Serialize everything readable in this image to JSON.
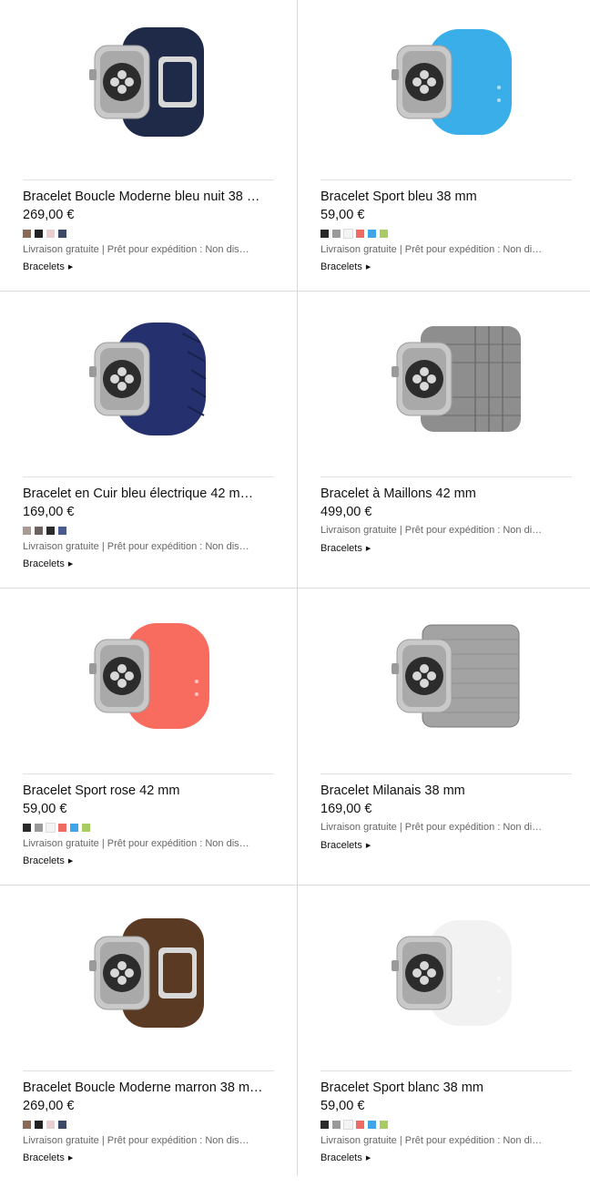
{
  "products": [
    {
      "name": "Bracelet Boucle Moderne bleu nuit 38 …",
      "price": "269,00 €",
      "swatches": [
        "#8a6a55",
        "#222222",
        "#e7cfcf",
        "#3d4a66"
      ],
      "shipping": "Livraison gratuite | Prêt pour expédition : Non dis…",
      "category": "Bracelets",
      "image": "midnight blue modern buckle band",
      "band_color": "#1e2a47"
    },
    {
      "name": "Bracelet Sport bleu 38 mm",
      "price": "59,00 €",
      "swatches": [
        "#2a2a2a",
        "#9a9a9a",
        "#f4f4f4",
        "#ee6b64",
        "#3ea6e8",
        "#a7cc63"
      ],
      "shipping": "Livraison gratuite | Prêt pour expédition : Non di…",
      "category": "Bracelets",
      "image": "blue sport band",
      "band_color": "#3aaee9"
    },
    {
      "name": "Bracelet en Cuir bleu électrique 42 m…",
      "price": "169,00 €",
      "swatches": [
        "#a99a92",
        "#6c6260",
        "#2b2b2b",
        "#4b5a8c"
      ],
      "shipping": "Livraison gratuite | Prêt pour expédition : Non dis…",
      "category": "Bracelets",
      "image": "bright blue leather loop",
      "band_color": "#25316e"
    },
    {
      "name": "Bracelet à Maillons 42 mm",
      "price": "499,00 €",
      "swatches": [],
      "shipping": "Livraison gratuite | Prêt pour expédition : Non di…",
      "category": "Bracelets",
      "image": "stainless steel link bracelet",
      "band_color": "#8e8e8e"
    },
    {
      "name": "Bracelet Sport rose 42 mm",
      "price": "59,00 €",
      "swatches": [
        "#2a2a2a",
        "#9a9a9a",
        "#f4f4f4",
        "#ee6b64",
        "#3ea6e8",
        "#a7cc63"
      ],
      "shipping": "Livraison gratuite | Prêt pour expédition : Non dis…",
      "category": "Bracelets",
      "image": "pink sport band",
      "band_color": "#f86c60"
    },
    {
      "name": "Bracelet Milanais 38 mm",
      "price": "169,00 €",
      "swatches": [],
      "shipping": "Livraison gratuite | Prêt pour expédition : Non di…",
      "category": "Bracelets",
      "image": "milanese loop",
      "band_color": "#a3a3a3"
    },
    {
      "name": "Bracelet Boucle Moderne marron 38 m…",
      "price": "269,00 €",
      "swatches": [
        "#8a6a55",
        "#222222",
        "#e7cfcf",
        "#3d4a66"
      ],
      "shipping": "Livraison gratuite | Prêt pour expédition : Non dis…",
      "category": "Bracelets",
      "image": "brown modern buckle band",
      "band_color": "#5a3a22"
    },
    {
      "name": "Bracelet Sport blanc 38 mm",
      "price": "59,00 €",
      "swatches": [
        "#2a2a2a",
        "#9a9a9a",
        "#f4f4f4",
        "#ee6b64",
        "#3ea6e8",
        "#a7cc63"
      ],
      "shipping": "Livraison gratuite | Prêt pour expédition : Non di…",
      "category": "Bracelets",
      "image": "white sport band",
      "band_color": "#f2f2f2"
    }
  ],
  "icons": {
    "category_arrow": "caret-right-icon"
  }
}
